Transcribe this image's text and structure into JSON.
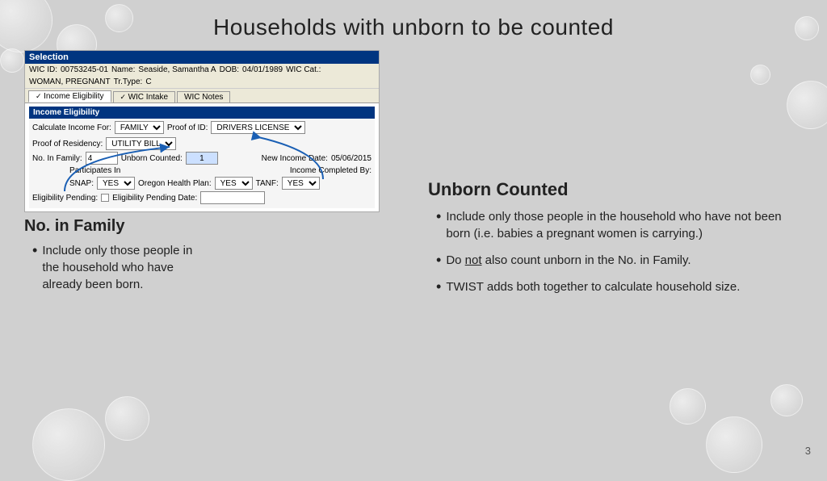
{
  "page": {
    "title": "Households with unborn to be counted",
    "slide_number": "3"
  },
  "selection_header": "Selection",
  "wic_fields": {
    "wic_id_label": "WIC ID:",
    "wic_id_value": "00753245-01",
    "name_label": "Name:",
    "name_value": "Seaside, Samantha A",
    "dob_label": "DOB:",
    "dob_value": "04/01/1989",
    "wic_cat_label": "WIC Cat.:",
    "wic_cat_value": "WOMAN, PREGNANT",
    "tr_type_label": "Tr.Type:",
    "tr_type_value": "C"
  },
  "tabs": [
    {
      "label": "Income Eligibility",
      "checked": true,
      "active": true
    },
    {
      "label": "WIC Intake",
      "checked": true,
      "active": false
    },
    {
      "label": "WIC Notes",
      "active": false
    }
  ],
  "income_eligibility_header": "Income Eligibility",
  "form_fields": {
    "calc_income_label": "Calculate Income For:",
    "calc_income_value": "FAMILY",
    "proof_id_label": "Proof of ID:",
    "proof_id_value": "DRIVERS LICENSE",
    "proof_residency_label": "Proof of Residency:",
    "proof_residency_value": "UTILITY BILL",
    "no_in_family_label": "No. In Family:",
    "no_in_family_value": "4",
    "unborn_counted_label": "Unborn Counted:",
    "unborn_counted_value": "1",
    "new_income_date_label": "New Income Date:",
    "new_income_date_value": "05/06/2015",
    "income_completed_label": "Income Completed By:",
    "income_completed_value": "",
    "participates_label": "Participates In",
    "snap_label": "SNAP:",
    "snap_value": "YES",
    "oregon_health_label": "Oregon Health Plan:",
    "oregon_health_value": "YES",
    "tanf_label": "TANF:",
    "tanf_value": "YES",
    "eligibility_pending_label": "Eligibility Pending:",
    "eligibility_pending_date_label": "Eligibility Pending Date:"
  },
  "left_annotation": {
    "title": "No. in Family",
    "bullets": [
      "Include only those people in the household who have already been born."
    ]
  },
  "right_annotation": {
    "title": "Unborn Counted",
    "bullets": [
      "Include only those people in the household who have not been born (i.e. babies a pregnant women is carrying.)",
      "Do not also count unborn in the No. in Family.",
      "TWIST adds both together to calculate household size."
    ],
    "underline_word": "not"
  }
}
